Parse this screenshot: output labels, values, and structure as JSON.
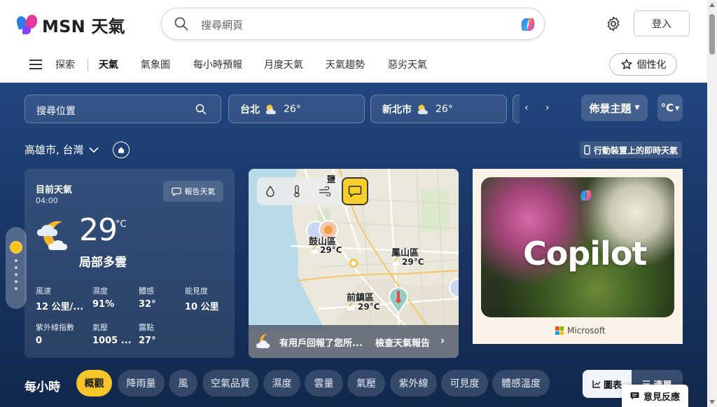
{
  "header": {
    "logo_text": "MSN 天氣",
    "search_placeholder": "搜尋網頁",
    "signin_label": "登入"
  },
  "nav": {
    "items": [
      {
        "label": "探索",
        "active": false
      },
      {
        "label": "天氣",
        "active": true
      },
      {
        "label": "氣象圖",
        "active": false
      },
      {
        "label": "每小時預報",
        "active": false
      },
      {
        "label": "月度天氣",
        "active": false
      },
      {
        "label": "天氣趨勢",
        "active": false
      },
      {
        "label": "惡劣天氣",
        "active": false
      }
    ],
    "personalize_label": "個性化"
  },
  "toolbar": {
    "location_search_placeholder": "搜尋位置",
    "city_chips": [
      {
        "name": "台北",
        "temp": "26°"
      },
      {
        "name": "新北市",
        "temp": "26°"
      }
    ],
    "theme_label": "佈景主題",
    "unit_label": "°C"
  },
  "location": {
    "city": "高雄市, 台灣",
    "mobile_label": "行動裝置上的即時天氣"
  },
  "current": {
    "title": "目前天氣",
    "time": "04:00",
    "report_label": "報告天氣",
    "temperature": "29",
    "unit": "°C",
    "condition": "局部多雲",
    "stats": [
      {
        "label": "風速",
        "value": "12 公里/..."
      },
      {
        "label": "濕度",
        "value": "91%"
      },
      {
        "label": "體感",
        "value": "32°"
      },
      {
        "label": "能見度",
        "value": "10 公里"
      },
      {
        "label": "紫外線指數",
        "value": "0"
      },
      {
        "label": "氣壓",
        "value": "1005 ..."
      },
      {
        "label": "露點",
        "value": "27°"
      }
    ]
  },
  "map": {
    "places": [
      {
        "name": "鼓山區",
        "temp": "29°C"
      },
      {
        "name": "鳳山區",
        "temp": "29°C"
      },
      {
        "name": "前鎮區",
        "temp": "29°C"
      }
    ],
    "top_fragment": "鹽",
    "footer_message": "有用戶回報了您所...",
    "footer_cta": "檢查天氣報告"
  },
  "ad": {
    "headline": "Copilot",
    "brand": "Microsoft"
  },
  "hourly": {
    "title": "每小時",
    "tabs": [
      {
        "label": "概觀",
        "active": true
      },
      {
        "label": "降雨量",
        "active": false
      },
      {
        "label": "風",
        "active": false
      },
      {
        "label": "空氣品質",
        "active": false
      },
      {
        "label": "濕度",
        "active": false
      },
      {
        "label": "雲量",
        "active": false
      },
      {
        "label": "氣壓",
        "active": false
      },
      {
        "label": "紫外線",
        "active": false
      },
      {
        "label": "可見度",
        "active": false
      },
      {
        "label": "體感溫度",
        "active": false
      }
    ],
    "view_options": [
      {
        "label": "圖表",
        "selected": true
      },
      {
        "label": "清單",
        "selected": false
      }
    ]
  },
  "feedback_label": "意見反應",
  "colors": {
    "accent_yellow": "#f6c52a",
    "hero_top": "#21467f",
    "hero_bottom": "#12284d"
  }
}
